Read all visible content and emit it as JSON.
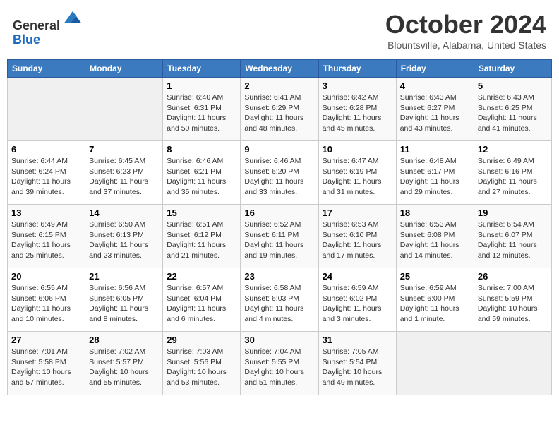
{
  "header": {
    "logo_line1": "General",
    "logo_line2": "Blue",
    "month_title": "October 2024",
    "location": "Blountsville, Alabama, United States"
  },
  "days_of_week": [
    "Sunday",
    "Monday",
    "Tuesday",
    "Wednesday",
    "Thursday",
    "Friday",
    "Saturday"
  ],
  "weeks": [
    [
      {
        "day": "",
        "sunrise": "",
        "sunset": "",
        "daylight": ""
      },
      {
        "day": "",
        "sunrise": "",
        "sunset": "",
        "daylight": ""
      },
      {
        "day": "1",
        "sunrise": "Sunrise: 6:40 AM",
        "sunset": "Sunset: 6:31 PM",
        "daylight": "Daylight: 11 hours and 50 minutes."
      },
      {
        "day": "2",
        "sunrise": "Sunrise: 6:41 AM",
        "sunset": "Sunset: 6:29 PM",
        "daylight": "Daylight: 11 hours and 48 minutes."
      },
      {
        "day": "3",
        "sunrise": "Sunrise: 6:42 AM",
        "sunset": "Sunset: 6:28 PM",
        "daylight": "Daylight: 11 hours and 45 minutes."
      },
      {
        "day": "4",
        "sunrise": "Sunrise: 6:43 AM",
        "sunset": "Sunset: 6:27 PM",
        "daylight": "Daylight: 11 hours and 43 minutes."
      },
      {
        "day": "5",
        "sunrise": "Sunrise: 6:43 AM",
        "sunset": "Sunset: 6:25 PM",
        "daylight": "Daylight: 11 hours and 41 minutes."
      }
    ],
    [
      {
        "day": "6",
        "sunrise": "Sunrise: 6:44 AM",
        "sunset": "Sunset: 6:24 PM",
        "daylight": "Daylight: 11 hours and 39 minutes."
      },
      {
        "day": "7",
        "sunrise": "Sunrise: 6:45 AM",
        "sunset": "Sunset: 6:23 PM",
        "daylight": "Daylight: 11 hours and 37 minutes."
      },
      {
        "day": "8",
        "sunrise": "Sunrise: 6:46 AM",
        "sunset": "Sunset: 6:21 PM",
        "daylight": "Daylight: 11 hours and 35 minutes."
      },
      {
        "day": "9",
        "sunrise": "Sunrise: 6:46 AM",
        "sunset": "Sunset: 6:20 PM",
        "daylight": "Daylight: 11 hours and 33 minutes."
      },
      {
        "day": "10",
        "sunrise": "Sunrise: 6:47 AM",
        "sunset": "Sunset: 6:19 PM",
        "daylight": "Daylight: 11 hours and 31 minutes."
      },
      {
        "day": "11",
        "sunrise": "Sunrise: 6:48 AM",
        "sunset": "Sunset: 6:17 PM",
        "daylight": "Daylight: 11 hours and 29 minutes."
      },
      {
        "day": "12",
        "sunrise": "Sunrise: 6:49 AM",
        "sunset": "Sunset: 6:16 PM",
        "daylight": "Daylight: 11 hours and 27 minutes."
      }
    ],
    [
      {
        "day": "13",
        "sunrise": "Sunrise: 6:49 AM",
        "sunset": "Sunset: 6:15 PM",
        "daylight": "Daylight: 11 hours and 25 minutes."
      },
      {
        "day": "14",
        "sunrise": "Sunrise: 6:50 AM",
        "sunset": "Sunset: 6:13 PM",
        "daylight": "Daylight: 11 hours and 23 minutes."
      },
      {
        "day": "15",
        "sunrise": "Sunrise: 6:51 AM",
        "sunset": "Sunset: 6:12 PM",
        "daylight": "Daylight: 11 hours and 21 minutes."
      },
      {
        "day": "16",
        "sunrise": "Sunrise: 6:52 AM",
        "sunset": "Sunset: 6:11 PM",
        "daylight": "Daylight: 11 hours and 19 minutes."
      },
      {
        "day": "17",
        "sunrise": "Sunrise: 6:53 AM",
        "sunset": "Sunset: 6:10 PM",
        "daylight": "Daylight: 11 hours and 17 minutes."
      },
      {
        "day": "18",
        "sunrise": "Sunrise: 6:53 AM",
        "sunset": "Sunset: 6:08 PM",
        "daylight": "Daylight: 11 hours and 14 minutes."
      },
      {
        "day": "19",
        "sunrise": "Sunrise: 6:54 AM",
        "sunset": "Sunset: 6:07 PM",
        "daylight": "Daylight: 11 hours and 12 minutes."
      }
    ],
    [
      {
        "day": "20",
        "sunrise": "Sunrise: 6:55 AM",
        "sunset": "Sunset: 6:06 PM",
        "daylight": "Daylight: 11 hours and 10 minutes."
      },
      {
        "day": "21",
        "sunrise": "Sunrise: 6:56 AM",
        "sunset": "Sunset: 6:05 PM",
        "daylight": "Daylight: 11 hours and 8 minutes."
      },
      {
        "day": "22",
        "sunrise": "Sunrise: 6:57 AM",
        "sunset": "Sunset: 6:04 PM",
        "daylight": "Daylight: 11 hours and 6 minutes."
      },
      {
        "day": "23",
        "sunrise": "Sunrise: 6:58 AM",
        "sunset": "Sunset: 6:03 PM",
        "daylight": "Daylight: 11 hours and 4 minutes."
      },
      {
        "day": "24",
        "sunrise": "Sunrise: 6:59 AM",
        "sunset": "Sunset: 6:02 PM",
        "daylight": "Daylight: 11 hours and 3 minutes."
      },
      {
        "day": "25",
        "sunrise": "Sunrise: 6:59 AM",
        "sunset": "Sunset: 6:00 PM",
        "daylight": "Daylight: 11 hours and 1 minute."
      },
      {
        "day": "26",
        "sunrise": "Sunrise: 7:00 AM",
        "sunset": "Sunset: 5:59 PM",
        "daylight": "Daylight: 10 hours and 59 minutes."
      }
    ],
    [
      {
        "day": "27",
        "sunrise": "Sunrise: 7:01 AM",
        "sunset": "Sunset: 5:58 PM",
        "daylight": "Daylight: 10 hours and 57 minutes."
      },
      {
        "day": "28",
        "sunrise": "Sunrise: 7:02 AM",
        "sunset": "Sunset: 5:57 PM",
        "daylight": "Daylight: 10 hours and 55 minutes."
      },
      {
        "day": "29",
        "sunrise": "Sunrise: 7:03 AM",
        "sunset": "Sunset: 5:56 PM",
        "daylight": "Daylight: 10 hours and 53 minutes."
      },
      {
        "day": "30",
        "sunrise": "Sunrise: 7:04 AM",
        "sunset": "Sunset: 5:55 PM",
        "daylight": "Daylight: 10 hours and 51 minutes."
      },
      {
        "day": "31",
        "sunrise": "Sunrise: 7:05 AM",
        "sunset": "Sunset: 5:54 PM",
        "daylight": "Daylight: 10 hours and 49 minutes."
      },
      {
        "day": "",
        "sunrise": "",
        "sunset": "",
        "daylight": ""
      },
      {
        "day": "",
        "sunrise": "",
        "sunset": "",
        "daylight": ""
      }
    ]
  ]
}
